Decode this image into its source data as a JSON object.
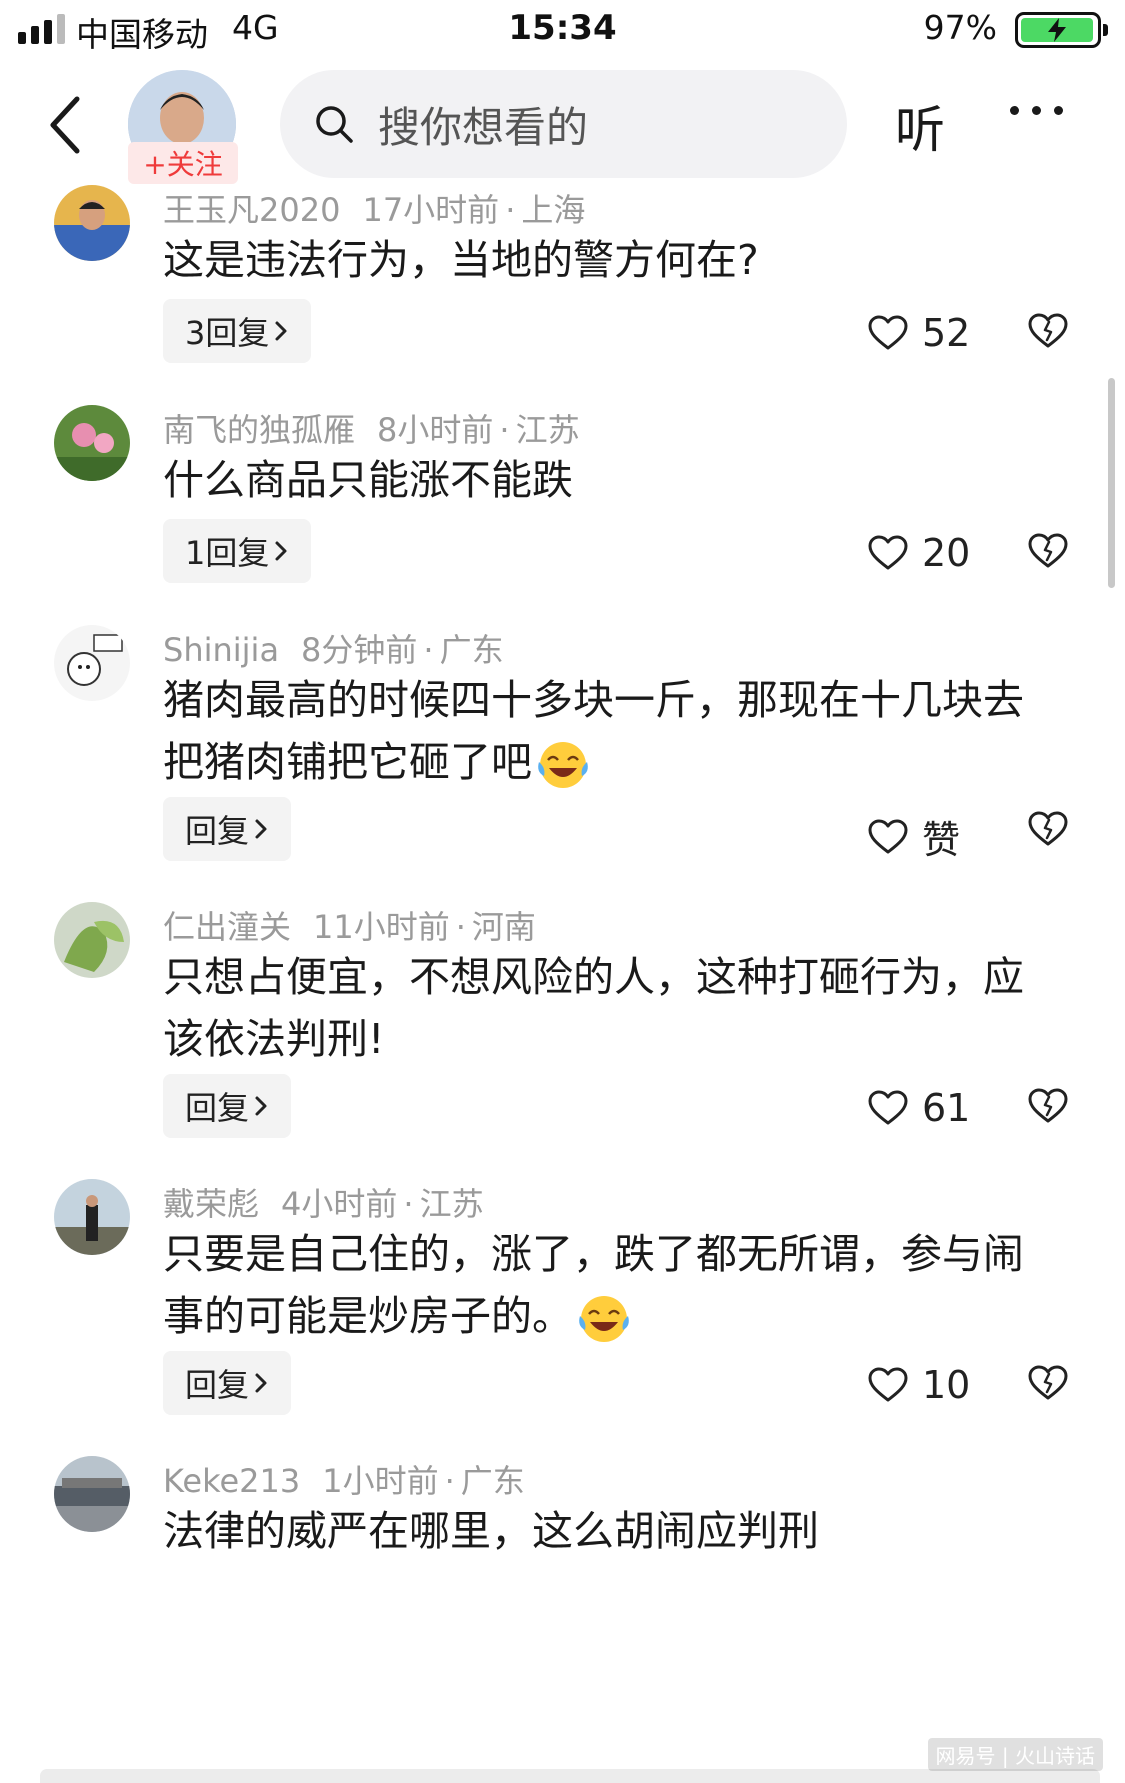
{
  "status_bar": {
    "carrier": "中国移动",
    "network": "4G",
    "time": "15:34",
    "battery_percent": "97%",
    "battery_level": 0.97,
    "signal_bars": 3
  },
  "header": {
    "follow_label": "+关注",
    "search_placeholder": "搜你想看的",
    "listen_label": "听"
  },
  "comments": [
    {
      "user": "王玉凡2020",
      "time": "17小时前",
      "location": "上海",
      "text": "这是违法行为，当地的警方何在?",
      "reply_label": "3回复",
      "likes": "52",
      "has_emoji": false
    },
    {
      "user": "南飞的独孤雁",
      "time": "8小时前",
      "location": "江苏",
      "text": "什么商品只能涨不能跌",
      "reply_label": "1回复",
      "likes": "20",
      "has_emoji": false
    },
    {
      "user": "Shinijia",
      "time": "8分钟前",
      "location": "广东",
      "text": "猪肉最高的时候四十多块一斤，那现在十几块去把猪肉铺把它砸了吧",
      "reply_label": "回复",
      "likes": "赞",
      "has_emoji": true
    },
    {
      "user": "仁出潼关",
      "time": "11小时前",
      "location": "河南",
      "text": "只想占便宜，不想风险的人，这种打砸行为，应该依法判刑!",
      "reply_label": "回复",
      "likes": "61",
      "has_emoji": false
    },
    {
      "user": "戴荣彪",
      "time": "4小时前",
      "location": "江苏",
      "text": "只要是自己住的，涨了，跌了都无所谓，参与闹事的可能是炒房子的。",
      "reply_label": "回复",
      "likes": "10",
      "has_emoji": true
    },
    {
      "user": "Keke213",
      "time": "1小时前",
      "location": "广东",
      "text": "法律的威严在哪里，这么胡闹应判刑",
      "reply_label": "",
      "likes": "",
      "has_emoji": false
    }
  ],
  "watermark": "网易号 | 火山诗话",
  "colors": {
    "accent_red": "#ef3b3b",
    "battery_green": "#4cd964",
    "meta_gray": "#9a9a9a"
  }
}
